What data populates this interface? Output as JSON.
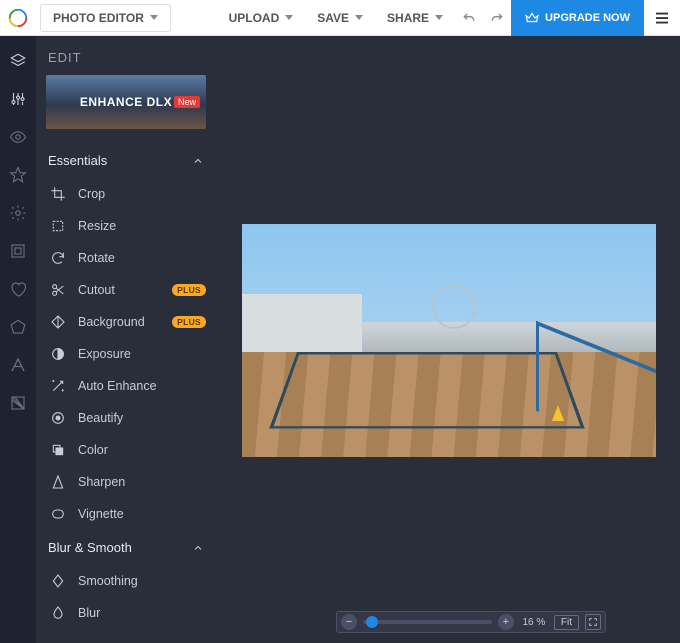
{
  "topbar": {
    "mode_label": "PHOTO EDITOR",
    "upload_label": "UPLOAD",
    "save_label": "SAVE",
    "share_label": "SHARE",
    "upgrade_label": "UPGRADE NOW"
  },
  "panel": {
    "title": "EDIT",
    "promo": {
      "text": "ENHANCE DLX",
      "badge": "New"
    }
  },
  "sections": [
    {
      "title": "Essentials",
      "items": [
        {
          "icon": "crop-icon",
          "label": "Crop"
        },
        {
          "icon": "resize-icon",
          "label": "Resize"
        },
        {
          "icon": "rotate-icon",
          "label": "Rotate"
        },
        {
          "icon": "cutout-icon",
          "label": "Cutout",
          "badge": "PLUS"
        },
        {
          "icon": "background-icon",
          "label": "Background",
          "badge": "PLUS"
        },
        {
          "icon": "exposure-icon",
          "label": "Exposure"
        },
        {
          "icon": "auto-enhance-icon",
          "label": "Auto Enhance"
        },
        {
          "icon": "beautify-icon",
          "label": "Beautify"
        },
        {
          "icon": "color-icon",
          "label": "Color"
        },
        {
          "icon": "sharpen-icon",
          "label": "Sharpen"
        },
        {
          "icon": "vignette-icon",
          "label": "Vignette"
        }
      ]
    },
    {
      "title": "Blur & Smooth",
      "items": [
        {
          "icon": "smoothing-icon",
          "label": "Smoothing"
        },
        {
          "icon": "blur-icon",
          "label": "Blur"
        }
      ]
    }
  ],
  "zoom": {
    "value_label": "16 %",
    "fit_label": "Fit"
  },
  "colors": {
    "accent": "#1e88e5",
    "plus_badge": "#f9a825",
    "new_badge": "#e53935"
  }
}
